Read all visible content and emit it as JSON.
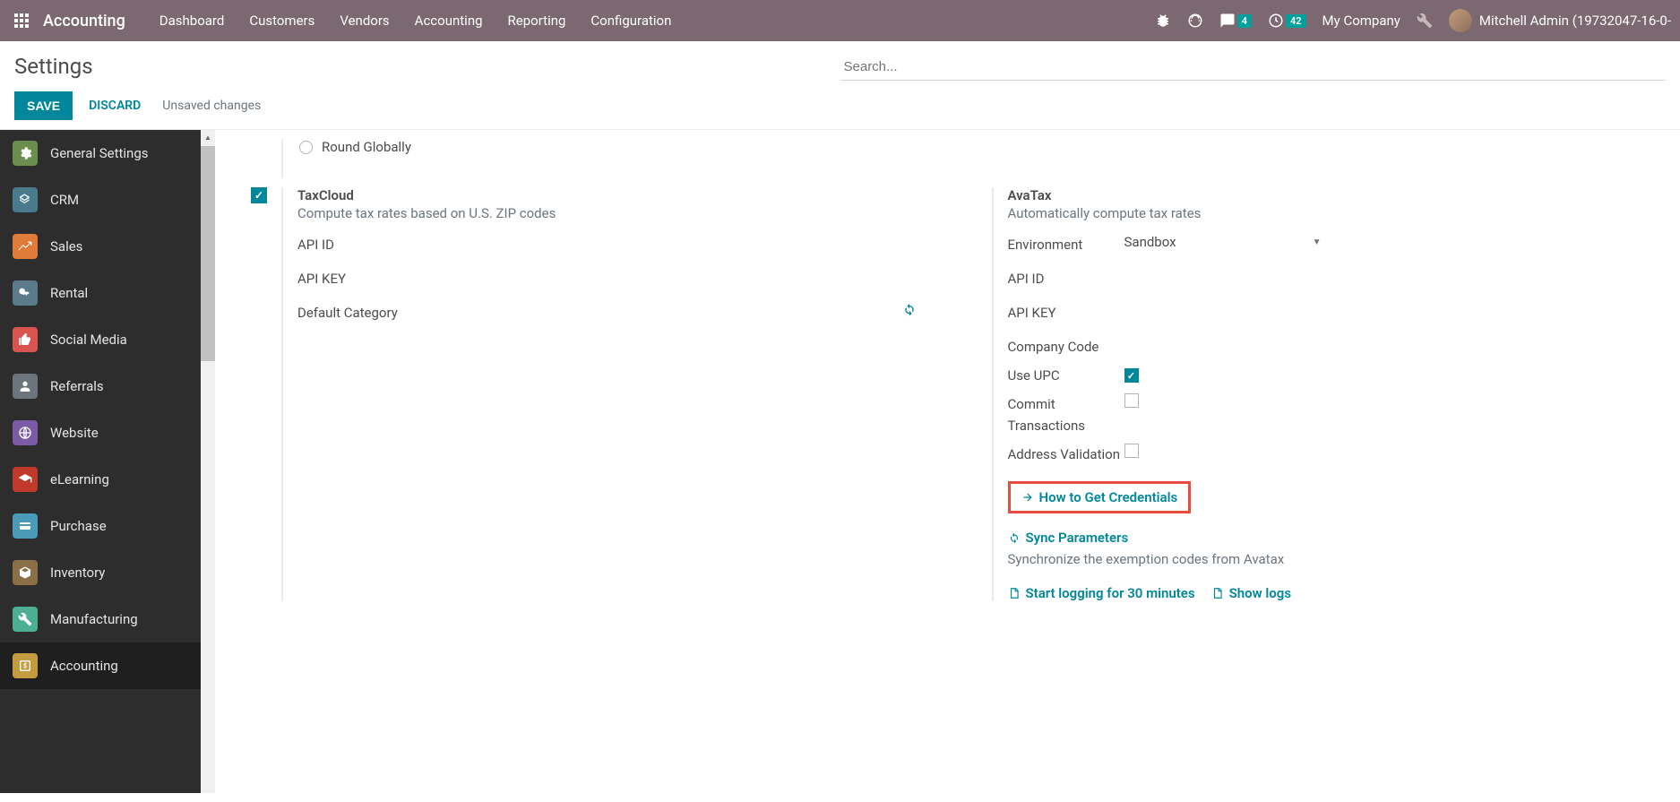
{
  "topnav": {
    "brand": "Accounting",
    "menu": [
      "Dashboard",
      "Customers",
      "Vendors",
      "Accounting",
      "Reporting",
      "Configuration"
    ],
    "messages_badge": "4",
    "activities_badge": "42",
    "company": "My Company",
    "user": "Mitchell Admin (19732047-16-0-"
  },
  "control": {
    "title": "Settings",
    "save": "SAVE",
    "discard": "DISCARD",
    "unsaved": "Unsaved changes",
    "search_placeholder": "Search..."
  },
  "sidebar": {
    "items": [
      {
        "label": "General Settings"
      },
      {
        "label": "CRM"
      },
      {
        "label": "Sales"
      },
      {
        "label": "Rental"
      },
      {
        "label": "Social Media"
      },
      {
        "label": "Referrals"
      },
      {
        "label": "Website"
      },
      {
        "label": "eLearning"
      },
      {
        "label": "Purchase"
      },
      {
        "label": "Inventory"
      },
      {
        "label": "Manufacturing"
      },
      {
        "label": "Accounting"
      }
    ]
  },
  "main": {
    "round_globally": "Round Globally",
    "taxcloud": {
      "title": "TaxCloud",
      "desc": "Compute tax rates based on U.S. ZIP codes",
      "api_id": "API ID",
      "api_key": "API KEY",
      "default_category": "Default Category"
    },
    "avatax": {
      "title": "AvaTax",
      "desc": "Automatically compute tax rates",
      "environment_label": "Environment",
      "environment_value": "Sandbox",
      "api_id": "API ID",
      "api_key": "API KEY",
      "company_code": "Company Code",
      "use_upc": "Use UPC",
      "commit_transactions": "Commit Transactions",
      "address_validation": "Address Validation",
      "how_to": "How to Get Credentials",
      "sync_params": "Sync Parameters",
      "sync_desc": "Synchronize the exemption codes from Avatax",
      "start_logging": "Start logging for 30 minutes",
      "show_logs": "Show logs"
    }
  }
}
